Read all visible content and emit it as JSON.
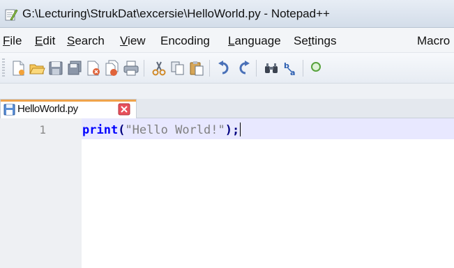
{
  "window": {
    "title": "G:\\Lecturing\\StrukDat\\excersie\\HelloWorld.py - Notepad++",
    "app_icon": "notepadpp-icon"
  },
  "menubar": {
    "items": [
      {
        "label": "File",
        "accel": "F",
        "rest": "ile"
      },
      {
        "label": "Edit",
        "accel": "E",
        "rest": "dit"
      },
      {
        "label": "Search",
        "accel": "S",
        "rest": "earch"
      },
      {
        "label": "View",
        "accel": "V",
        "rest": "iew"
      },
      {
        "label": "Encoding",
        "pre": "Encoding"
      },
      {
        "label": "Language",
        "accel": "L",
        "rest": "anguage"
      },
      {
        "label": "Settings",
        "pre": "Se",
        "accel": "t",
        "rest": "tings"
      },
      {
        "label": "Macro",
        "pre": "Macro"
      }
    ]
  },
  "toolbar": {
    "icons": [
      "new-file-icon",
      "open-file-icon",
      "save-icon",
      "save-all-icon",
      "close-icon",
      "close-all-icon",
      "print-icon",
      "cut-icon",
      "copy-icon",
      "paste-icon",
      "undo-icon",
      "redo-icon",
      "find-icon",
      "replace-icon",
      "zoom-icon"
    ]
  },
  "tabs": [
    {
      "label": "HelloWorld.py",
      "active": true
    }
  ],
  "editor": {
    "line_number": "1",
    "code": {
      "keyword": "print",
      "open_paren": "(",
      "string": "\"Hello World!\"",
      "close": ");"
    }
  },
  "colors": {
    "accent_tab": "#f0a34b",
    "keyword": "#0000ff",
    "string": "#808080",
    "operator": "#000080",
    "current_line": "#e8e8ff"
  }
}
